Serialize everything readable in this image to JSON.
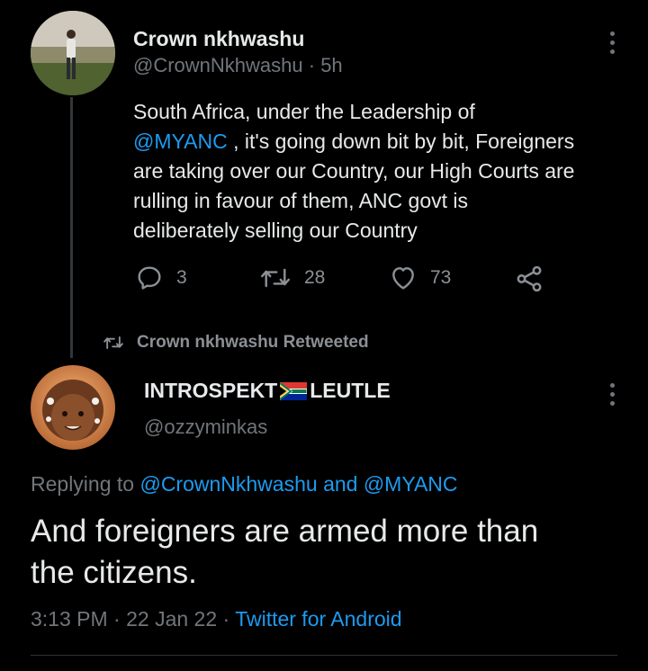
{
  "tweet1": {
    "name": "Crown nkhwashu",
    "handle": "@CrownNkhwashu",
    "time": "· 5h",
    "text_line1": "South Africa, under the Leadership of",
    "mention": "@MYANC",
    "text_line2_rest": " , it's going down bit by bit, Foreigners",
    "text_line3": "are taking over our Country, our High Courts are",
    "text_line4": "rulling in favour of them, ANC govt is",
    "text_line5": "deliberately selling our Country",
    "replies": "3",
    "retweets": "28",
    "likes": "73"
  },
  "retweet_notice": "Crown nkhwashu Retweeted",
  "tweet2": {
    "name_part1": "INTROSPEKT",
    "name_part2": "LEUTLE",
    "handle": "@ozzyminkas",
    "replying_prefix": "Replying to",
    "replying_user1": "@CrownNkhwashu",
    "replying_and": "and",
    "replying_user2": "@MYANC",
    "text_line1": "And foreigners are armed more than",
    "text_line2": "the citizens.",
    "time": "3:13 PM",
    "date": "22 Jan 22",
    "sep": "·",
    "source": "Twitter for Android"
  },
  "icons": {
    "reply": "reply-icon",
    "retweet": "retweet-icon",
    "like": "heart-icon",
    "share": "share-icon",
    "menu": "more-icon",
    "flag": "south-africa-flag-icon"
  },
  "colors": {
    "background": "#000000",
    "text": "#e7e9ea",
    "muted": "#71767b",
    "link": "#1d9bf0"
  }
}
